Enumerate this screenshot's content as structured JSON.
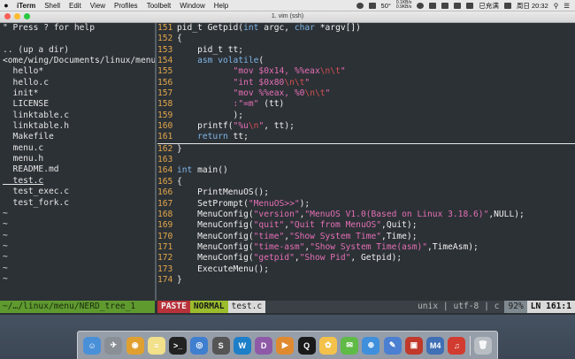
{
  "menubar": {
    "app": "iTerm",
    "items": [
      "Shell",
      "Edit",
      "View",
      "Profiles",
      "Toolbelt",
      "Window",
      "Help"
    ],
    "temp": "50°",
    "net_up": "0.1KB/s",
    "net_down": "0.9KB/s",
    "battery": "已充满",
    "time": "周日 20:32"
  },
  "window": {
    "title": "1. vim (ssh)"
  },
  "nerdtree": {
    "help": "\" Press ? for help",
    "updir": ".. (up a dir)",
    "path": "<ome/wing/Documents/linux/menu/",
    "files": [
      {
        "name": "hello*",
        "cls": "c-pink"
      },
      {
        "name": "hello.c",
        "cls": ""
      },
      {
        "name": "init*",
        "cls": "c-pink"
      },
      {
        "name": "LICENSE",
        "cls": ""
      },
      {
        "name": "linktable.c",
        "cls": ""
      },
      {
        "name": "linktable.h",
        "cls": ""
      },
      {
        "name": "Makefile",
        "cls": ""
      },
      {
        "name": "menu.c",
        "cls": ""
      },
      {
        "name": "menu.h",
        "cls": ""
      },
      {
        "name": "README.md",
        "cls": ""
      },
      {
        "name": "test.c",
        "cls": "cur"
      },
      {
        "name": "test_exec.c",
        "cls": ""
      },
      {
        "name": "test_fork.c",
        "cls": ""
      }
    ],
    "tilde": "~",
    "tilde_count": 7
  },
  "code": {
    "lines": [
      {
        "n": "151",
        "html": "pid_t Getpid(<span class=\"k\">int</span> argc, <span class=\"k\">char</span> *argv[])"
      },
      {
        "n": "152",
        "html": "{"
      },
      {
        "n": "153",
        "html": "    pid_t tt;"
      },
      {
        "n": "154",
        "html": "    <span class=\"k\">asm volatile</span>("
      },
      {
        "n": "155",
        "html": "           <span class=\"s\">\"mov $0x14, %%eax<span class=\"esc\">\\n\\t</span>\"</span>"
      },
      {
        "n": "156",
        "html": "           <span class=\"s\">\"int $0x80<span class=\"esc\">\\n\\t</span>\"</span>"
      },
      {
        "n": "157",
        "html": "           <span class=\"s\">\"mov %%eax, %0<span class=\"esc\">\\n\\t</span>\"</span>"
      },
      {
        "n": "158",
        "html": "           <span class=\"s\">:\"=m\"</span> (tt)"
      },
      {
        "n": "159",
        "html": "           );"
      },
      {
        "n": "160",
        "html": "    printf(<span class=\"s\">\"%u<span class=\"esc\">\\n</span>\"</span>, tt);"
      },
      {
        "n": "161",
        "html": "    <span class=\"k\">return</span> tt;",
        "current": true
      },
      {
        "n": "162",
        "html": "}"
      },
      {
        "n": "163",
        "html": ""
      },
      {
        "n": "164",
        "html": "<span class=\"k\">int</span> main()"
      },
      {
        "n": "165",
        "html": "{"
      },
      {
        "n": "166",
        "html": "    PrintMenuOS();"
      },
      {
        "n": "167",
        "html": "    SetPrompt(<span class=\"s\">\"MenuOS>>\"</span>);"
      },
      {
        "n": "168",
        "html": "    MenuConfig(<span class=\"s\">\"version\"</span>,<span class=\"s\">\"MenuOS V1.0(Based on Linux 3.18.6)\"</span>,NULL);"
      },
      {
        "n": "169",
        "html": "    MenuConfig(<span class=\"s\">\"quit\"</span>,<span class=\"s\">\"Quit from MenuOS\"</span>,Quit);"
      },
      {
        "n": "170",
        "html": "    MenuConfig(<span class=\"s\">\"time\"</span>,<span class=\"s\">\"Show System Time\"</span>,Time);"
      },
      {
        "n": "171",
        "html": "    MenuConfig(<span class=\"s\">\"time-asm\"</span>,<span class=\"s\">\"Show System Time(asm)\"</span>,TimeAsm);"
      },
      {
        "n": "172",
        "html": "    MenuConfig(<span class=\"s\">\"getpid\"</span>,<span class=\"s\">\"Show Pid\"</span>, Getpid);"
      },
      {
        "n": "173",
        "html": "    ExecuteMenu();"
      },
      {
        "n": "174",
        "html": "}"
      }
    ]
  },
  "status": {
    "tree": "~/…/linux/menu/NERD_tree_1",
    "mode": "PASTE",
    "normal": "NORMAL",
    "file": "test.c",
    "fileformat": "unix",
    "encoding": "utf-8",
    "filetype": "c",
    "percent": "92%",
    "position": "LN 161:1"
  },
  "dock": {
    "apps": [
      {
        "name": "finder",
        "color": "#4a90d9",
        "glyph": "☺"
      },
      {
        "name": "launchpad",
        "color": "#8a8f96",
        "glyph": "✈"
      },
      {
        "name": "chrome",
        "color": "#e0a030",
        "glyph": "◉"
      },
      {
        "name": "notes",
        "color": "#f2e08a",
        "glyph": "≡"
      },
      {
        "name": "terminal",
        "color": "#222222",
        "glyph": ">_"
      },
      {
        "name": "chromium",
        "color": "#3f7fd0",
        "glyph": "◎"
      },
      {
        "name": "sublime",
        "color": "#555555",
        "glyph": "S"
      },
      {
        "name": "webstorm",
        "color": "#1e7fc9",
        "glyph": "W"
      },
      {
        "name": "dash",
        "color": "#8e5aa8",
        "glyph": "D"
      },
      {
        "name": "slides",
        "color": "#e08a30",
        "glyph": "▶"
      },
      {
        "name": "qq",
        "color": "#1a1a1a",
        "glyph": "Q"
      },
      {
        "name": "photos",
        "color": "#f4c24a",
        "glyph": "✿"
      },
      {
        "name": "wechat",
        "color": "#5fba46",
        "glyph": "✉"
      },
      {
        "name": "safari",
        "color": "#3f8fdc",
        "glyph": "⊕"
      },
      {
        "name": "xcode",
        "color": "#4b7fd1",
        "glyph": "✎"
      },
      {
        "name": "vmware",
        "color": "#c0392b",
        "glyph": "▣"
      },
      {
        "name": "m4",
        "color": "#3f6fb5",
        "glyph": "M4"
      },
      {
        "name": "netease",
        "color": "#d23b2f",
        "glyph": "♫"
      },
      {
        "name": "trash",
        "color": "#b9bec4",
        "glyph": "🗑"
      }
    ]
  }
}
